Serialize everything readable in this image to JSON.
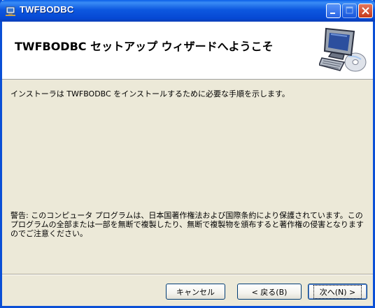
{
  "window": {
    "title": "TWFBODBC"
  },
  "banner": {
    "heading": "TWFBODBC セットアップ ウィザードへようこそ"
  },
  "body": {
    "intro": "インストーラは TWFBODBC をインストールするために必要な手順を示します。",
    "warning": "警告: このコンピュータ プログラムは、日本国著作権法および国際条約により保護されています。このプログラムの全部または一部を無断で複製したり、無断で複製物を頒布すると著作権の侵害となりますのでご注意ください。"
  },
  "buttons": {
    "cancel": "キャンセル",
    "back": "< 戻る(B)",
    "next": "次へ(N) >"
  },
  "colors": {
    "titlebar": "#0a4fd6",
    "dialog_bg": "#ece9d8",
    "close_button": "#c4391a"
  }
}
